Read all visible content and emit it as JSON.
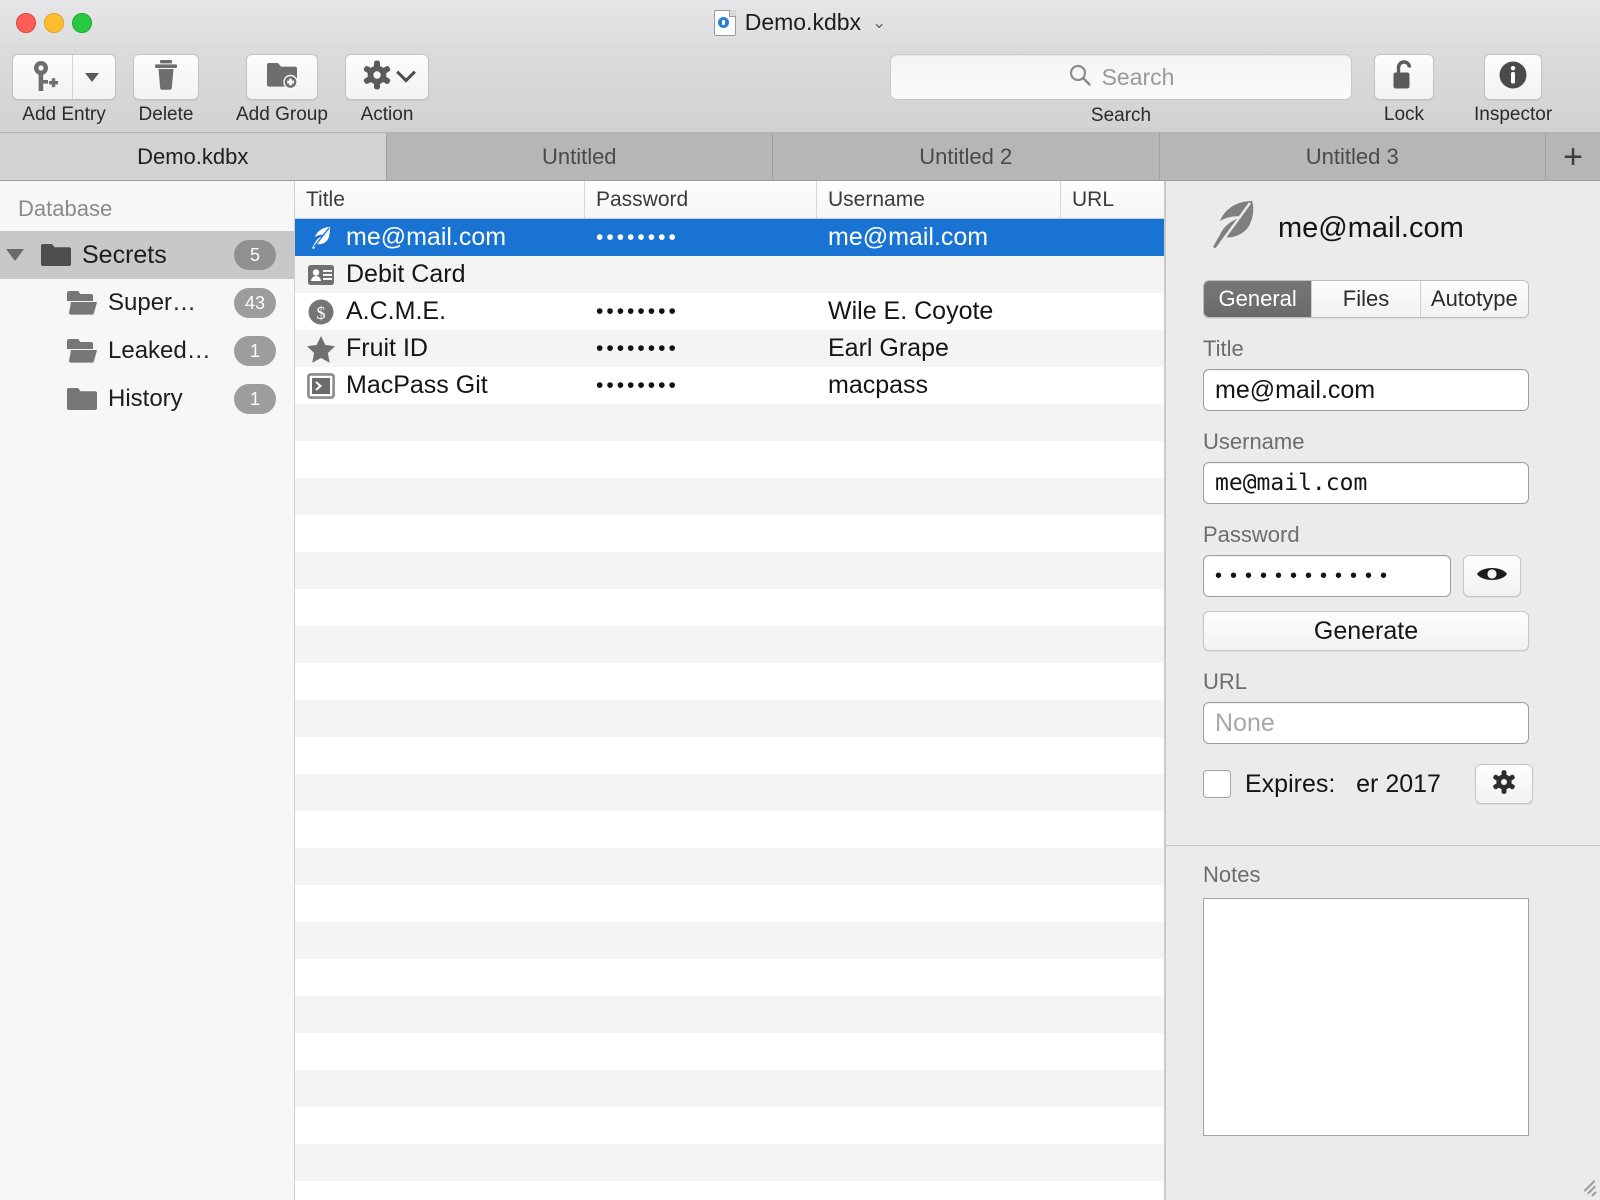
{
  "window": {
    "title": "Demo.kdbx",
    "title_chevron": "chevron-down-icon",
    "traffic": {
      "close": "close",
      "minimize": "minimize",
      "maximize": "maximize"
    }
  },
  "toolbar": {
    "buttons": [
      {
        "label": "Add Entry",
        "icon": "key-plus-icon",
        "has_dropdown": true
      },
      {
        "label": "Delete",
        "icon": "trash-icon",
        "has_dropdown": false
      },
      {
        "label": "Add Group",
        "icon": "folder-plus-icon",
        "has_dropdown": false
      },
      {
        "label": "Action",
        "icon": "gear-icon",
        "has_dropdown": true
      }
    ],
    "search": {
      "placeholder": "Search",
      "value": "",
      "caption": "Search",
      "icon": "search-icon"
    },
    "lock": {
      "label": "Lock",
      "icon": "padlock-open-icon"
    },
    "inspector": {
      "label": "Inspector",
      "icon": "info-circle-icon"
    }
  },
  "tabs": {
    "items": [
      {
        "label": "Demo.kdbx",
        "active": true
      },
      {
        "label": "Untitled",
        "active": false
      },
      {
        "label": "Untitled 2",
        "active": false
      },
      {
        "label": "Untitled 3",
        "active": false
      }
    ],
    "add_label": "+"
  },
  "sidebar": {
    "header": "Database",
    "items": [
      {
        "label": "Secrets",
        "count": "5",
        "level": 0,
        "selected": true,
        "expanded": true,
        "icon": "folder-icon"
      },
      {
        "label": "Super…",
        "count": "43",
        "level": 1,
        "selected": false,
        "expanded": false,
        "icon": "folder-stack-icon"
      },
      {
        "label": "Leaked…",
        "count": "1",
        "level": 1,
        "selected": false,
        "expanded": false,
        "icon": "folder-stack-icon"
      },
      {
        "label": "History",
        "count": "1",
        "level": 1,
        "selected": false,
        "expanded": false,
        "icon": "folder-icon"
      }
    ]
  },
  "table": {
    "columns": [
      "Title",
      "Password",
      "Username",
      "URL"
    ],
    "rows": [
      {
        "icon": "feather-icon",
        "title": "me@mail.com",
        "password": "••••••••",
        "username": "me@mail.com",
        "url": "",
        "selected": true
      },
      {
        "icon": "id-card-icon",
        "title": "Debit Card",
        "password": "",
        "username": "",
        "url": "",
        "selected": false
      },
      {
        "icon": "dollar-icon",
        "title": "A.C.M.E.",
        "password": "••••••••",
        "username": "Wile E. Coyote",
        "url": "",
        "selected": false
      },
      {
        "icon": "star-icon",
        "title": "Fruit ID",
        "password": "••••••••",
        "username": "Earl Grape",
        "url": "",
        "selected": false
      },
      {
        "icon": "terminal-icon",
        "title": "MacPass Git",
        "password": "••••••••",
        "username": "macpass",
        "url": "",
        "selected": false
      }
    ],
    "empty_row_count": 21
  },
  "inspector": {
    "icon": "feather-icon",
    "title": "me@mail.com",
    "tabs": [
      {
        "label": "General",
        "active": true
      },
      {
        "label": "Files",
        "active": false
      },
      {
        "label": "Autotype",
        "active": false
      }
    ],
    "fields": {
      "title_label": "Title",
      "title_value": "me@mail.com",
      "username_label": "Username",
      "username_value": "me@mail.com",
      "password_label": "Password",
      "password_value": "••••••••••••",
      "reveal_icon": "eye-icon",
      "generate_label": "Generate",
      "url_label": "URL",
      "url_placeholder": "None",
      "url_value": "",
      "expires_label": "Expires:",
      "expires_value": "er 2017",
      "expires_checked": false,
      "expires_settings_icon": "gear-icon"
    },
    "notes": {
      "label": "Notes",
      "value": ""
    }
  },
  "colors": {
    "selection_blue": "#1873d3",
    "sidebar_selection": "#c8c8c8",
    "toolbar_bg": "#d6d6d6",
    "titlebar_bg": "#e2e2e4",
    "inspector_bg": "#ebebeb"
  }
}
